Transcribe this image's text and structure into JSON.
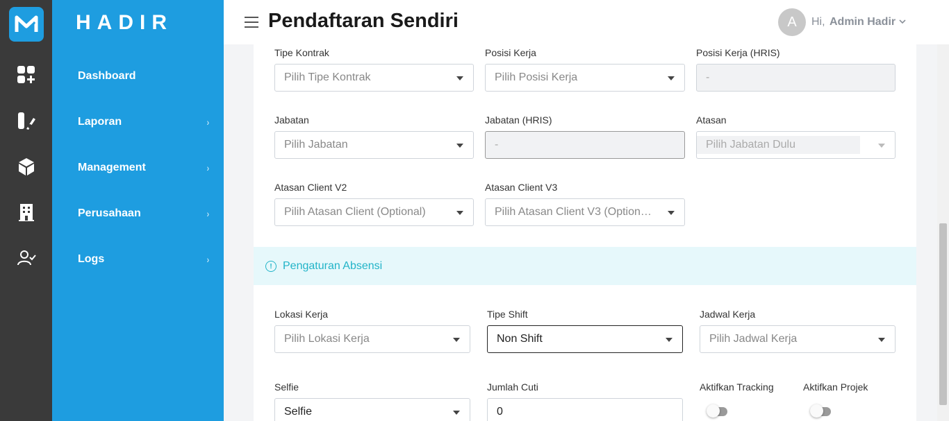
{
  "app": {
    "brand": "HADIR"
  },
  "header": {
    "title": "Pendaftaran Sendiri",
    "avatar_letter": "A",
    "greeting": "Hi,",
    "user_name": "Admin Hadir"
  },
  "nav": {
    "items": [
      {
        "label": "Dashboard",
        "has_chevron": false
      },
      {
        "label": "Laporan",
        "has_chevron": true
      },
      {
        "label": "Management",
        "has_chevron": true
      },
      {
        "label": "Perusahaan",
        "has_chevron": true
      },
      {
        "label": "Logs",
        "has_chevron": true
      }
    ],
    "chevron": "›"
  },
  "rail_icons": [
    "dashboard-add-icon",
    "report-icon",
    "cube-icon",
    "building-icon",
    "user-check-icon"
  ],
  "form": {
    "tipe_kontrak": {
      "label": "Tipe Kontrak",
      "placeholder": "Pilih Tipe Kontrak"
    },
    "posisi_kerja": {
      "label": "Posisi Kerja",
      "placeholder": "Pilih Posisi Kerja"
    },
    "posisi_kerja_hris": {
      "label": "Posisi Kerja (HRIS)",
      "value": "-"
    },
    "jabatan": {
      "label": "Jabatan",
      "placeholder": "Pilih Jabatan"
    },
    "jabatan_hris": {
      "label": "Jabatan (HRIS)",
      "value": "-"
    },
    "atasan": {
      "label": "Atasan",
      "placeholder": "Pilih Jabatan Dulu"
    },
    "atasan_client_v2": {
      "label": "Atasan Client V2",
      "placeholder": "Pilih Atasan Client (Optional)"
    },
    "atasan_client_v3": {
      "label": "Atasan Client V3",
      "placeholder": "Pilih Atasan Client V3 (Option…"
    }
  },
  "absensi": {
    "section_title": "Pengaturan Absensi",
    "info_glyph": "!",
    "lokasi_kerja": {
      "label": "Lokasi Kerja",
      "placeholder": "Pilih Lokasi Kerja"
    },
    "tipe_shift": {
      "label": "Tipe Shift",
      "value": "Non Shift"
    },
    "jadwal_kerja": {
      "label": "Jadwal Kerja",
      "placeholder": "Pilih Jadwal Kerja"
    },
    "selfie": {
      "label": "Selfie",
      "value": "Selfie"
    },
    "jumlah_cuti": {
      "label": "Jumlah Cuti",
      "value": "0"
    },
    "aktifkan_tracking": {
      "label": "Aktifkan Tracking",
      "on": false
    },
    "aktifkan_projek": {
      "label": "Aktifkan Projek",
      "on": false
    }
  }
}
